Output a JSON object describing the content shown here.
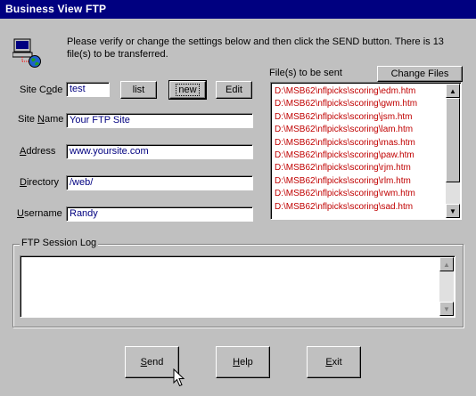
{
  "window": {
    "title": "Business View FTP"
  },
  "intro_text": "Please verify or change the settings below and then click the SEND button.  There is 13 file(s) to be transferred.",
  "form": {
    "site_code": {
      "label_pre": "Site C",
      "label_u": "o",
      "label_post": "de",
      "value": "test"
    },
    "site_name": {
      "label_pre": "Site ",
      "label_u": "N",
      "label_post": "ame",
      "value": "Your FTP Site"
    },
    "address": {
      "label_pre": "",
      "label_u": "A",
      "label_post": "ddress",
      "value": "www.yoursite.com"
    },
    "directory": {
      "label_pre": "",
      "label_u": "D",
      "label_post": "irectory",
      "value": "/web/"
    },
    "username": {
      "label_pre": "",
      "label_u": "U",
      "label_post": "sername",
      "value": "Randy"
    }
  },
  "buttons": {
    "list": "list",
    "new": "new",
    "edit": "Edit",
    "change_files": "Change Files",
    "send_u": "S",
    "send_rest": "end",
    "help_u": "H",
    "help_rest": "elp",
    "exit_u": "E",
    "exit_rest": "xit"
  },
  "files_label": "File(s) to be sent",
  "files": [
    "D:\\MSB62\\nflpicks\\scoring\\edm.htm",
    "D:\\MSB62\\nflpicks\\scoring\\gwm.htm",
    "D:\\MSB62\\nflpicks\\scoring\\jsm.htm",
    "D:\\MSB62\\nflpicks\\scoring\\lam.htm",
    "D:\\MSB62\\nflpicks\\scoring\\mas.htm",
    "D:\\MSB62\\nflpicks\\scoring\\paw.htm",
    "D:\\MSB62\\nflpicks\\scoring\\rjm.htm",
    "D:\\MSB62\\nflpicks\\scoring\\rlm.htm",
    "D:\\MSB62\\nflpicks\\scoring\\rwm.htm",
    "D:\\MSB62\\nflpicks\\scoring\\sad.htm"
  ],
  "session_log_label": "FTP Session Log",
  "icons": {
    "app": "computer-globe-icon",
    "scroll_up": "scroll-up-icon",
    "scroll_down": "scroll-down-icon",
    "cursor": "mouse-pointer-icon"
  }
}
